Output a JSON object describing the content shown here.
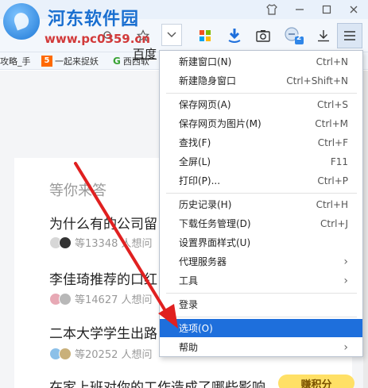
{
  "watermark": {
    "title": "河东软件园",
    "url": "www.pc0359.cn"
  },
  "browser": {
    "bookmarks": [
      {
        "label": "攻略_手"
      },
      {
        "label": "一起来捉妖",
        "icon": "5"
      },
      {
        "label": "西西软",
        "icon": "G"
      }
    ]
  },
  "page": {
    "baidu_link": "百度",
    "section_title": "等你来答",
    "questions": [
      {
        "title": "为什么有的公司留",
        "meta": "等13348 人想问"
      },
      {
        "title": "李佳琦推荐的口红",
        "meta": "等14627 人想问"
      },
      {
        "title": "二本大学学生出路",
        "meta": "等20252 人想问"
      },
      {
        "title": "在家上班对你的工作造成了哪些影响",
        "meta": ""
      }
    ],
    "earn_badge": "赚积分"
  },
  "menu": {
    "items": [
      {
        "label": "新建窗口(N)",
        "shortcut": "Ctrl+N"
      },
      {
        "label": "新建隐身窗口",
        "shortcut": "Ctrl+Shift+N"
      },
      {
        "label": "保存网页(A)",
        "shortcut": "Ctrl+S"
      },
      {
        "label": "保存网页为图片(M)",
        "shortcut": "Ctrl+M"
      },
      {
        "label": "查找(F)",
        "shortcut": "Ctrl+F"
      },
      {
        "label": "全屏(L)",
        "shortcut": "F11"
      },
      {
        "label": "打印(P)...",
        "shortcut": "Ctrl+P"
      },
      {
        "label": "历史记录(H)",
        "shortcut": "Ctrl+H"
      },
      {
        "label": "下载任务管理(D)",
        "shortcut": "Ctrl+J"
      },
      {
        "label": "设置界面样式(U)",
        "shortcut": ""
      },
      {
        "label": "代理服务器",
        "shortcut": ""
      },
      {
        "label": "工具",
        "shortcut": ""
      },
      {
        "label": "登录",
        "shortcut": ""
      },
      {
        "label": "选项(O)",
        "shortcut": ""
      },
      {
        "label": "帮助",
        "shortcut": ""
      }
    ]
  },
  "colors": {
    "menu_highlight": "#1e6fdc",
    "annotation": "#e02020",
    "brand": "#1a6fd0"
  },
  "icons": [
    "shirt-icon",
    "minimize-icon",
    "restore-icon",
    "close-icon",
    "zoom-icon",
    "star-icon",
    "apps-icon",
    "download-shield-icon",
    "screenshot-icon",
    "notification-icon",
    "download-icon",
    "menu-icon"
  ],
  "notification_count": "2"
}
